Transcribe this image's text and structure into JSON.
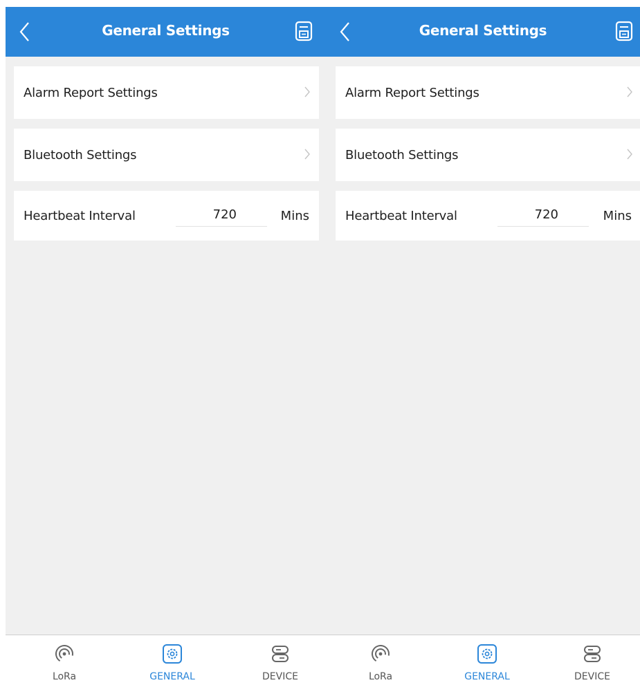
{
  "colors": {
    "header_bg": "#2b86d9",
    "accent": "#2b86d9",
    "page_bg": "#f0f0f0",
    "card_bg": "#ffffff",
    "text": "#1f1f1f",
    "tab_inactive": "#555555"
  },
  "screens": [
    {
      "header": {
        "title": "General Settings",
        "back_icon": "chevron-left-icon",
        "save_icon": "save-icon"
      },
      "settings": {
        "alarm_label": "Alarm Report Settings",
        "bluetooth_label": "Bluetooth Settings",
        "heartbeat_label": "Heartbeat Interval",
        "heartbeat_value": "720",
        "heartbeat_unit": "Mins"
      },
      "tabs": [
        {
          "label": "LoRa",
          "icon": "lora-signal-icon",
          "active": false
        },
        {
          "label": "GENERAL",
          "icon": "gear-icon",
          "active": true
        },
        {
          "label": "DEVICE",
          "icon": "device-icon",
          "active": false
        }
      ]
    },
    {
      "header": {
        "title": "General Settings",
        "back_icon": "chevron-left-icon",
        "save_icon": "save-icon"
      },
      "settings": {
        "alarm_label": "Alarm Report Settings",
        "bluetooth_label": "Bluetooth Settings",
        "heartbeat_label": "Heartbeat Interval",
        "heartbeat_value": "720",
        "heartbeat_unit": "Mins"
      },
      "tabs": [
        {
          "label": "LoRa",
          "icon": "lora-signal-icon",
          "active": false
        },
        {
          "label": "GENERAL",
          "icon": "gear-icon",
          "active": true
        },
        {
          "label": "DEVICE",
          "icon": "device-icon",
          "active": false
        }
      ]
    }
  ]
}
